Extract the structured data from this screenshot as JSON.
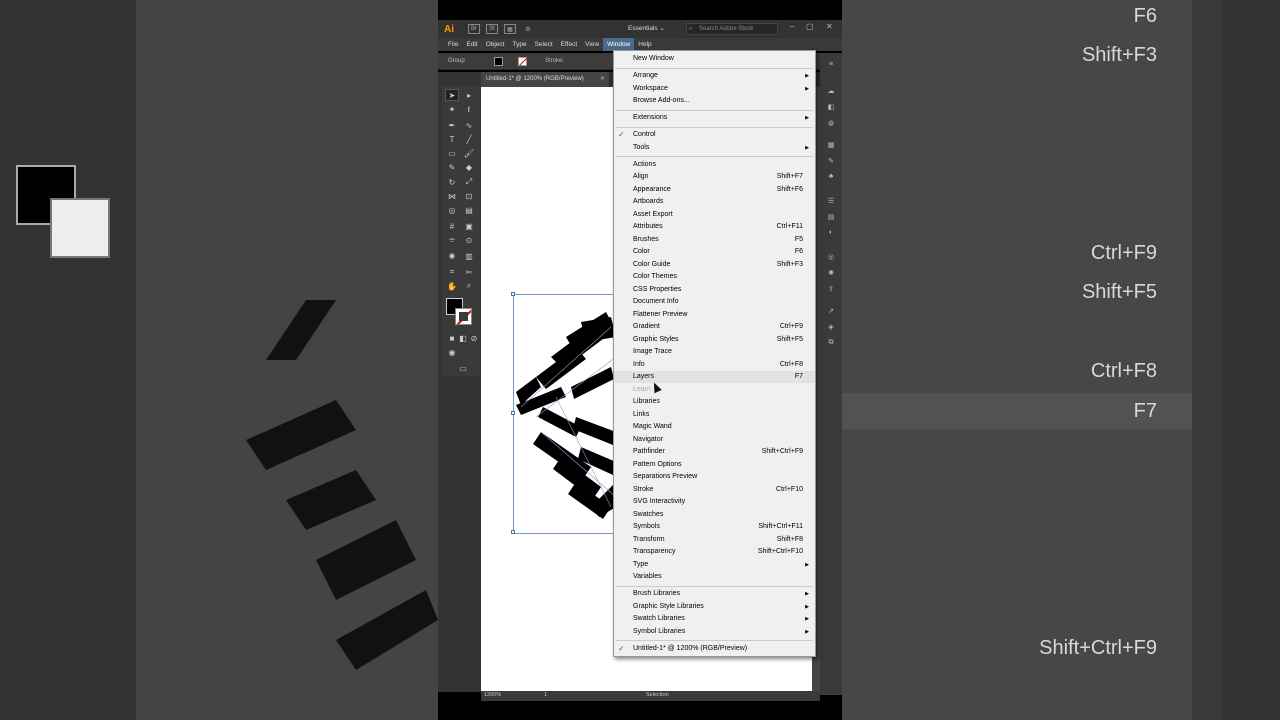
{
  "app": {
    "logo": "Ai",
    "workspace": "Essentials",
    "search_placeholder": "Search Adobe Stock"
  },
  "menubar": {
    "items": [
      "File",
      "Edit",
      "Object",
      "Type",
      "Select",
      "Effect",
      "View",
      "Window",
      "Help"
    ],
    "active": "Window"
  },
  "controlbar": {
    "selection_label": "Group",
    "stroke_label": "Stroke:"
  },
  "document": {
    "tab_title": "Untitled-1* @ 1200% (RGB/Preview)",
    "zoom": "1200%",
    "artboard_number": "1",
    "status_tool": "Selection"
  },
  "window_menu": {
    "groups": [
      [
        {
          "label": "New Window"
        }
      ],
      [
        {
          "label": "Arrange",
          "submenu": true
        },
        {
          "label": "Workspace",
          "submenu": true
        },
        {
          "label": "Browse Add-ons..."
        }
      ],
      [
        {
          "label": "Extensions",
          "submenu": true
        }
      ],
      [
        {
          "label": "Control",
          "checked": true
        },
        {
          "label": "Tools",
          "submenu": true
        }
      ],
      [
        {
          "label": "Actions"
        },
        {
          "label": "Align",
          "shortcut": "Shift+F7"
        },
        {
          "label": "Appearance",
          "shortcut": "Shift+F6"
        },
        {
          "label": "Artboards"
        },
        {
          "label": "Asset Export"
        },
        {
          "label": "Attributes",
          "shortcut": "Ctrl+F11"
        },
        {
          "label": "Brushes",
          "shortcut": "F5"
        },
        {
          "label": "Color",
          "shortcut": "F6"
        },
        {
          "label": "Color Guide",
          "shortcut": "Shift+F3"
        },
        {
          "label": "Color Themes"
        },
        {
          "label": "CSS Properties"
        },
        {
          "label": "Document Info"
        },
        {
          "label": "Flattener Preview"
        },
        {
          "label": "Gradient",
          "shortcut": "Ctrl+F9"
        },
        {
          "label": "Graphic Styles",
          "shortcut": "Shift+F5"
        },
        {
          "label": "Image Trace"
        },
        {
          "label": "Info",
          "shortcut": "Ctrl+F8"
        },
        {
          "label": "Layers",
          "shortcut": "F7",
          "highlighted": true
        },
        {
          "label": "Learn",
          "disabled": true
        },
        {
          "label": "Libraries"
        },
        {
          "label": "Links"
        },
        {
          "label": "Magic Wand"
        },
        {
          "label": "Navigator"
        },
        {
          "label": "Pathfinder",
          "shortcut": "Shift+Ctrl+F9"
        },
        {
          "label": "Pattern Options"
        },
        {
          "label": "Separations Preview"
        },
        {
          "label": "Stroke",
          "shortcut": "Ctrl+F10"
        },
        {
          "label": "SVG Interactivity"
        },
        {
          "label": "Swatches"
        },
        {
          "label": "Symbols",
          "shortcut": "Shift+Ctrl+F11"
        },
        {
          "label": "Transform",
          "shortcut": "Shift+F8"
        },
        {
          "label": "Transparency",
          "shortcut": "Shift+Ctrl+F10"
        },
        {
          "label": "Type",
          "submenu": true
        },
        {
          "label": "Variables"
        }
      ],
      [
        {
          "label": "Brush Libraries",
          "submenu": true
        },
        {
          "label": "Graphic Style Libraries",
          "submenu": true
        },
        {
          "label": "Swatch Libraries",
          "submenu": true
        },
        {
          "label": "Symbol Libraries",
          "submenu": true
        }
      ],
      [
        {
          "label": "Untitled-1* @ 1200% (RGB/Preview)",
          "checked": true
        }
      ]
    ]
  },
  "background_shortcuts": [
    "F6",
    "Shift+F3",
    "Ctrl+F9",
    "Shift+F5",
    "Ctrl+F8",
    "F7",
    "Shift+Ctrl+F9"
  ],
  "colors": {
    "accent": "#3060b0",
    "logo": "#ff9a00",
    "menu_bg": "#f0f0f0",
    "chrome": "#3a3a3a"
  }
}
